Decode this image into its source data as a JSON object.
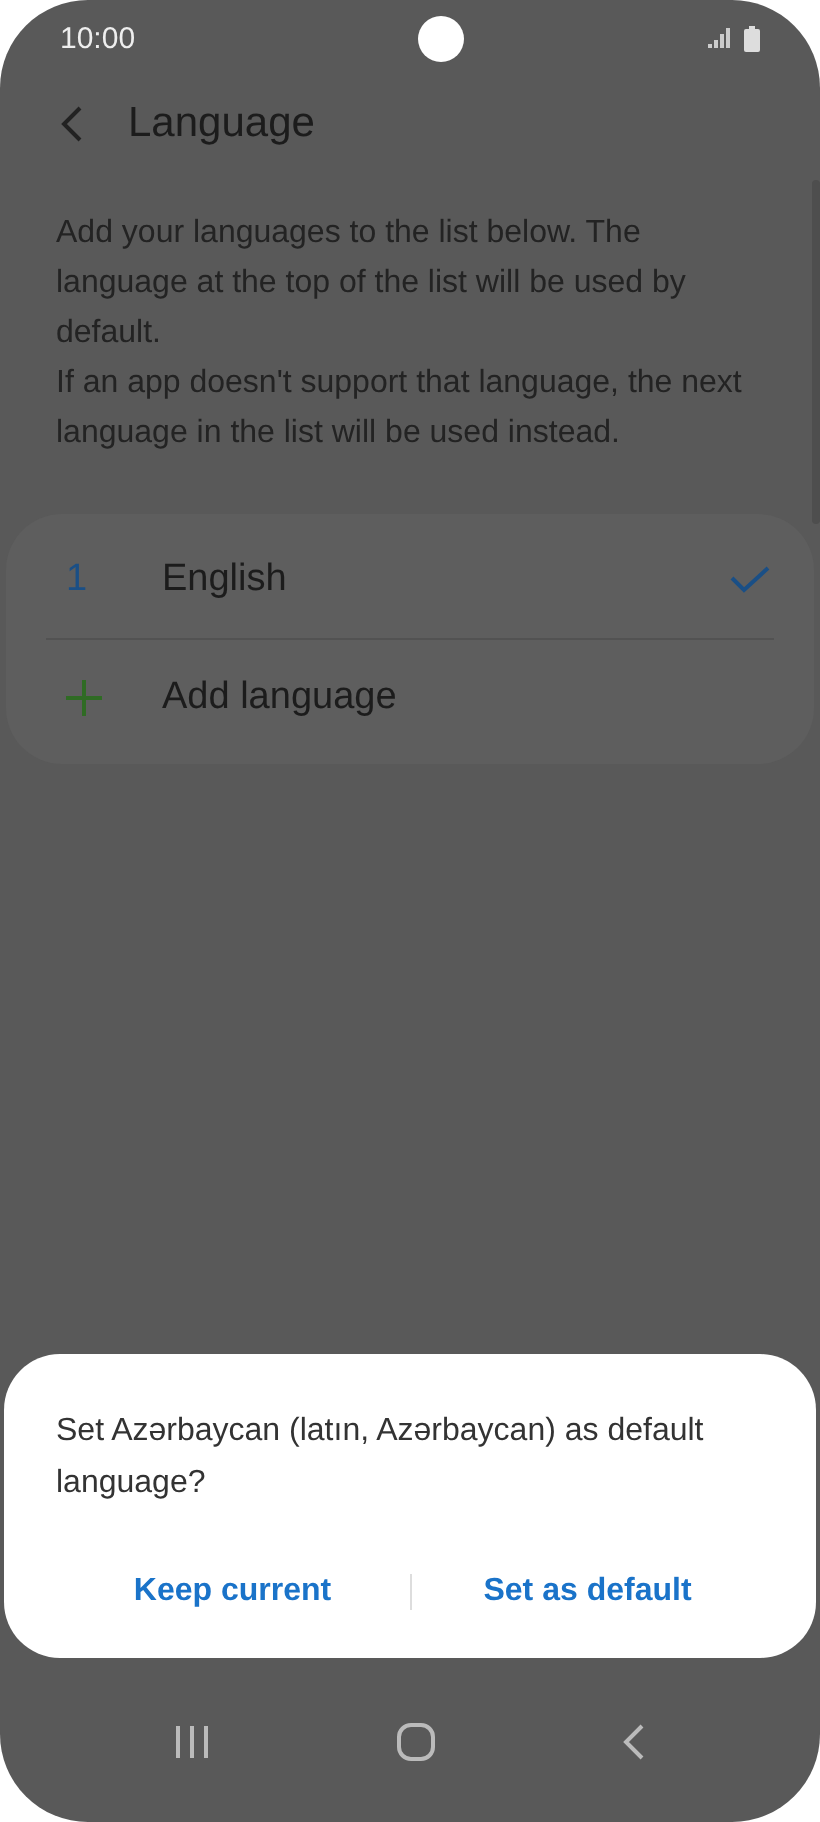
{
  "status_bar": {
    "time": "10:00"
  },
  "header": {
    "title": "Language"
  },
  "description": [
    "Add your languages to the list below. The language at the top of the list will be used by default.",
    "If an app doesn't support that language, the next language in the list will be used instead."
  ],
  "languages": [
    {
      "number": "1",
      "name": "English",
      "selected": true
    }
  ],
  "add_language": {
    "label": "Add language"
  },
  "dialog": {
    "message": "Set Azərbaycan (latın, Azərbaycan) as default language?",
    "buttons": [
      "Keep current",
      "Set as default"
    ]
  }
}
